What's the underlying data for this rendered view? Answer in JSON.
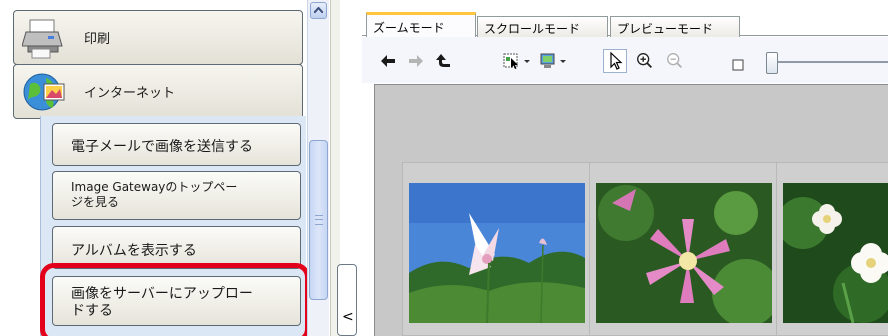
{
  "left_pane": {
    "categories": [
      {
        "label": "印刷",
        "icon": "printer-icon"
      },
      {
        "label": "インターネット",
        "icon": "internet-globe-icon"
      }
    ],
    "tasks": [
      {
        "label": "電子メールで画像を送信する"
      },
      {
        "label_line1": "Image Gatewayのトップペー",
        "label_line2": "ジを見る"
      },
      {
        "label": "アルバムを表示する"
      },
      {
        "label_line1": "画像をサーバーにアップロー",
        "label_line2": "ドする"
      }
    ],
    "highlight_color": "#e3001b"
  },
  "collapse_glyph": "<",
  "viewer": {
    "tabs": [
      "ズームモード",
      "スクロールモード",
      "プレビューモード"
    ],
    "active_tab": 0,
    "toolbar_icons": [
      "back-arrow-icon",
      "forward-arrow-icon",
      "up-level-icon",
      "select-mode-icon",
      "display-mode-icon",
      "pointer-icon",
      "zoom-in-icon",
      "zoom-out-icon",
      "small-thumbnail-icon",
      "thumbnail-size-slider"
    ],
    "thumbnails": [
      "flower-photo-sky",
      "clematis-photo",
      "white-flower-photo"
    ]
  },
  "colors": {
    "tab_accent": "#ffc83c",
    "canvas_bg": "#c8c8c8",
    "panel_bg": "#dbe7f5"
  }
}
